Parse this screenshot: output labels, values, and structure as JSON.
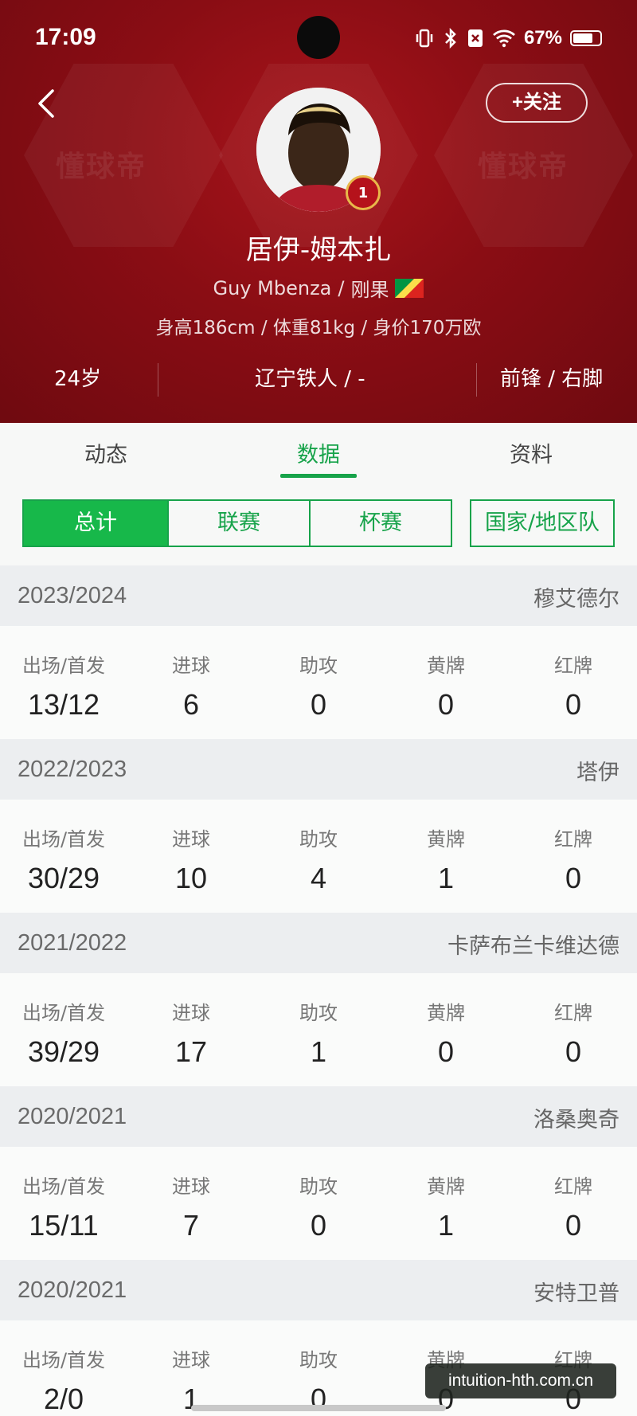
{
  "status_bar": {
    "time": "17:09",
    "battery": "67%",
    "battery_level": 0.67
  },
  "header": {
    "follow_label": "+关注",
    "watermark_text": "懂球帝",
    "player_name": "居伊-姆本扎",
    "english_name": "Guy Mbenza",
    "nationality": "刚果",
    "physical_info": "身高186cm / 体重81kg / 身价170万欧",
    "age": "24岁",
    "club_number": "辽宁铁人 / -",
    "position_foot": "前锋 / 右脚",
    "club_badge_text": "1",
    "colors": {
      "bg": "#8a0d14",
      "accent": "#17a34a"
    }
  },
  "tabs": [
    {
      "label": "动态",
      "active": false
    },
    {
      "label": "数据",
      "active": true
    },
    {
      "label": "资料",
      "active": false
    }
  ],
  "filters": {
    "group": [
      {
        "label": "总计",
        "active": true
      },
      {
        "label": "联赛",
        "active": false
      },
      {
        "label": "杯赛",
        "active": false
      }
    ],
    "national_team": "国家/地区队"
  },
  "stat_labels": [
    "出场/首发",
    "进球",
    "助攻",
    "黄牌",
    "红牌"
  ],
  "seasons": [
    {
      "season": "2023/2024",
      "club": "穆艾德尔",
      "values": [
        "13/12",
        "6",
        "0",
        "0",
        "0"
      ]
    },
    {
      "season": "2022/2023",
      "club": "塔伊",
      "values": [
        "30/29",
        "10",
        "4",
        "1",
        "0"
      ]
    },
    {
      "season": "2021/2022",
      "club": "卡萨布兰卡维达德",
      "values": [
        "39/29",
        "17",
        "1",
        "0",
        "0"
      ]
    },
    {
      "season": "2020/2021",
      "club": "洛桑奥奇",
      "values": [
        "15/11",
        "7",
        "0",
        "1",
        "0"
      ]
    },
    {
      "season": "2020/2021",
      "club": "安特卫普",
      "values": [
        "2/0",
        "1",
        "0",
        "0",
        "0"
      ]
    }
  ],
  "site_watermark": "intuition-hth.com.cn"
}
